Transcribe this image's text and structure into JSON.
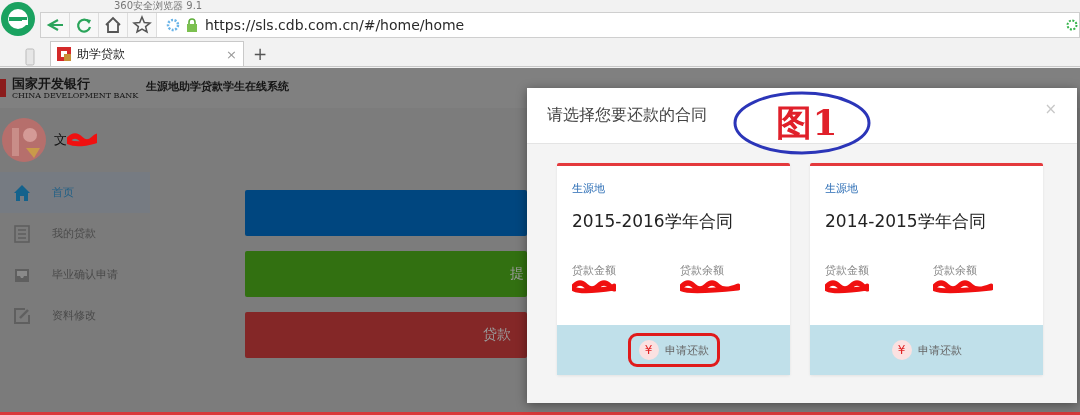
{
  "browser": {
    "title": "360安全浏览器 9.1",
    "url": "https://sls.cdb.com.cn/#/home/home",
    "tabs": [
      {
        "label": "助学贷款",
        "selected": true,
        "close": "×"
      }
    ],
    "new_tab": "+"
  },
  "header": {
    "bank_name": "国家开发银行",
    "bank_name_en": "CHINA DEVELOPMENT BANK",
    "system_title": "生源地助学贷款学生在线系统"
  },
  "user": {
    "name": "文",
    "redacted": true
  },
  "sidebar": {
    "items": [
      {
        "kind": "home",
        "label": "首页",
        "selected": true
      },
      {
        "kind": "list",
        "label": "我的贷款",
        "selected": false
      },
      {
        "kind": "inbox",
        "label": "毕业确认申请",
        "selected": false
      },
      {
        "kind": "edit",
        "label": "资料修改",
        "selected": false
      }
    ]
  },
  "main": {
    "bars": [
      {
        "color": "#00467f"
      },
      {
        "color": "#327011",
        "label": "提"
      },
      {
        "color": "#842727",
        "label": "贷款"
      }
    ]
  },
  "modal": {
    "title": "请选择您要还款的合同",
    "close": "×",
    "annotation": "图1",
    "contracts": [
      {
        "source": "生源地",
        "title": "2015-2016学年合同",
        "amounts": [
          {
            "label": "贷款金额",
            "redacted": true
          },
          {
            "label": "贷款余额",
            "redacted": true
          }
        ],
        "action_icon": "¥",
        "action": "申请还款",
        "highlighted": true
      },
      {
        "source": "生源地",
        "title": "2014-2015学年合同",
        "amounts": [
          {
            "label": "贷款金额",
            "redacted": true
          },
          {
            "label": "贷款余额",
            "redacted": true
          }
        ],
        "action_icon": "¥",
        "action": "申请还款",
        "highlighted": false
      }
    ]
  }
}
